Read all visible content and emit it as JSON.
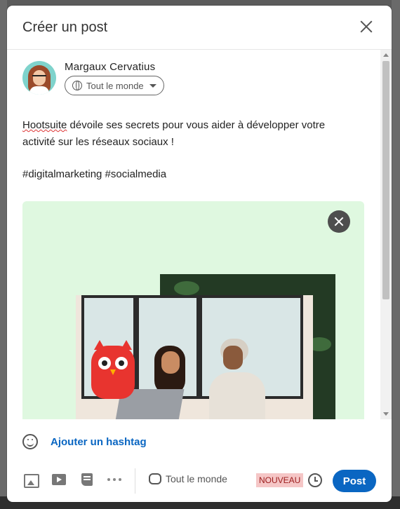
{
  "dialog": {
    "title": "Créer un post"
  },
  "author": {
    "name": "Margaux Cervatius",
    "audience": "Tout le monde"
  },
  "post": {
    "text_first_word": "Hootsuite",
    "text_rest": " dévoile ses secrets pour vous aider à développer votre activité sur les réseaux sociaux !",
    "hashtags": "#digitalmarketing #socialmedia"
  },
  "actions": {
    "add_hashtag": "Ajouter un hashtag",
    "comment_scope": "Tout le monde",
    "new_badge": "NOUVEAU",
    "post_button": "Post"
  },
  "colors": {
    "accent": "#0a66c2",
    "media_background": "#dff8e0",
    "badge_background": "#f5c6c6"
  },
  "icons": [
    "close-icon",
    "globe-icon",
    "caret-down-icon",
    "emoji-icon",
    "photo-icon",
    "video-icon",
    "document-icon",
    "more-icon",
    "comment-bubble-icon",
    "clock-icon"
  ]
}
